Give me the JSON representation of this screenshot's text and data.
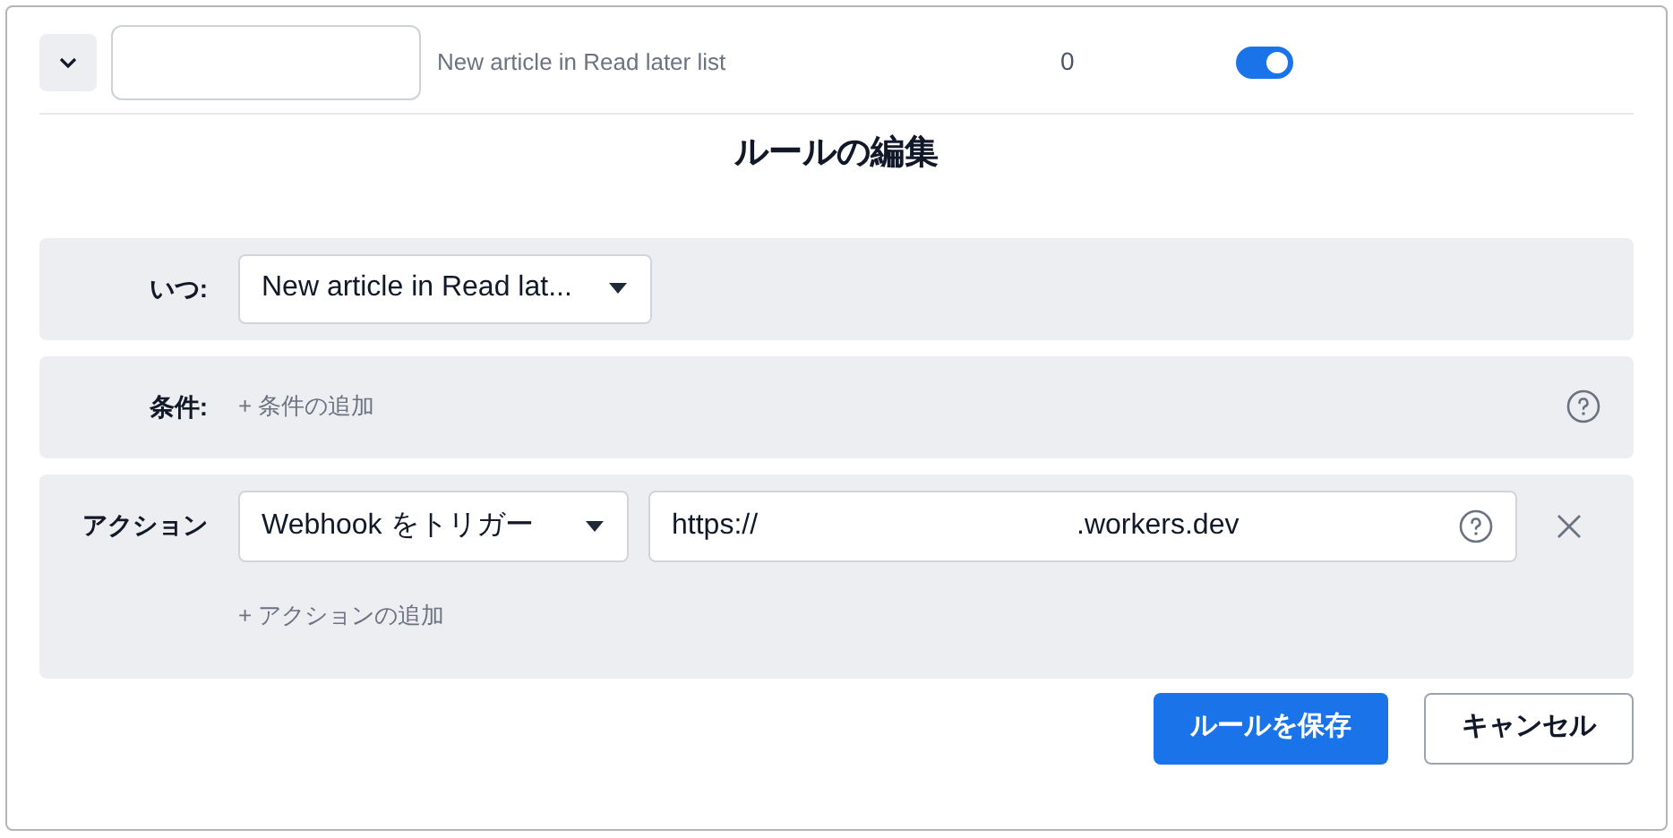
{
  "rule_row": {
    "expanded": true,
    "trigger_label": "New article in Read later list",
    "count": "0",
    "enabled": true
  },
  "title": "ルールの編集",
  "when": {
    "label": "いつ:",
    "select": "New article in Read lat..."
  },
  "conditions": {
    "label": "条件:",
    "add_link": "+ 条件の追加"
  },
  "actions": {
    "label": "アクション",
    "items": [
      {
        "select": "Webhook をトリガー",
        "url_start": "https://",
        "url_end": ".workers.dev"
      }
    ],
    "add_link": "+ アクションの追加"
  },
  "buttons": [
    {
      "kind": "primary",
      "label": "ルールを保存"
    },
    {
      "kind": "secondary",
      "label": "キャンセル"
    }
  ]
}
